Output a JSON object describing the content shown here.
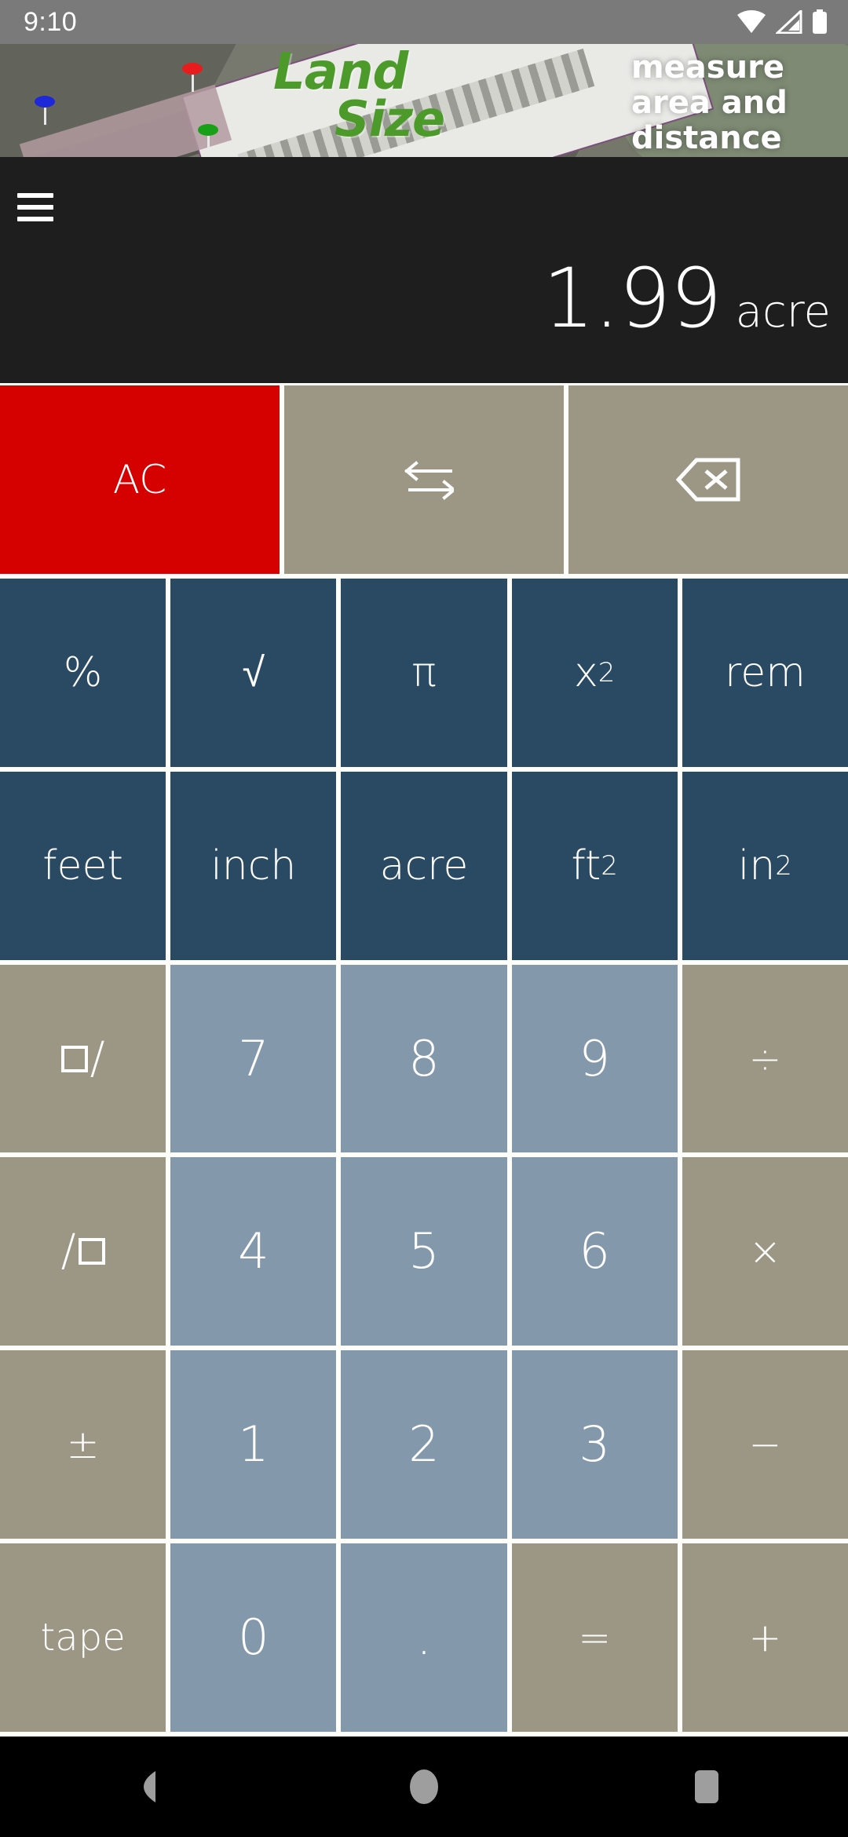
{
  "status_bar": {
    "time": "9:10",
    "icons": [
      "wifi-icon",
      "cell-signal-icon",
      "battery-icon"
    ]
  },
  "ad_banner": {
    "logo_line1": "Land",
    "logo_line2": "Size",
    "tagline_line1": "measure",
    "tagline_line2": "area and",
    "tagline_line3": "distance",
    "pins": [
      "red-map-pin",
      "blue-map-pin",
      "green-map-pin"
    ]
  },
  "display": {
    "menu_icon": "hamburger-menu-icon",
    "value": "1.99",
    "unit": "acre"
  },
  "keypad": {
    "row_top": [
      {
        "name": "all-clear-button",
        "label": "AC",
        "style": "ac"
      },
      {
        "name": "swap-units-button",
        "label": "⇆",
        "style": "tan"
      },
      {
        "name": "backspace-button",
        "label": "⌫",
        "style": "tan"
      }
    ],
    "row_functions": [
      {
        "name": "percent-button",
        "label": "%",
        "style": "blue"
      },
      {
        "name": "square-root-button",
        "label": "√",
        "style": "blue"
      },
      {
        "name": "pi-button",
        "label": "π",
        "style": "blue"
      },
      {
        "name": "x-squared-button",
        "label": "x²",
        "style": "blue"
      },
      {
        "name": "remainder-button",
        "label": "rem",
        "style": "blue"
      }
    ],
    "row_units": [
      {
        "name": "unit-feet-button",
        "label": "feet",
        "style": "blue"
      },
      {
        "name": "unit-inch-button",
        "label": "inch",
        "style": "blue"
      },
      {
        "name": "unit-acre-button",
        "label": "acre",
        "style": "blue"
      },
      {
        "name": "unit-square-feet-button",
        "label": "ft²",
        "style": "blue"
      },
      {
        "name": "unit-square-inch-button",
        "label": "in²",
        "style": "blue"
      }
    ],
    "row_7": [
      {
        "name": "fraction-numerator-button",
        "label": "□/",
        "style": "tan"
      },
      {
        "name": "digit-7-button",
        "label": "7",
        "style": "digit"
      },
      {
        "name": "digit-8-button",
        "label": "8",
        "style": "digit"
      },
      {
        "name": "digit-9-button",
        "label": "9",
        "style": "digit"
      },
      {
        "name": "divide-button",
        "label": "÷",
        "style": "tan"
      }
    ],
    "row_4": [
      {
        "name": "fraction-denominator-button",
        "label": "/□",
        "style": "tan"
      },
      {
        "name": "digit-4-button",
        "label": "4",
        "style": "digit"
      },
      {
        "name": "digit-5-button",
        "label": "5",
        "style": "digit"
      },
      {
        "name": "digit-6-button",
        "label": "6",
        "style": "digit"
      },
      {
        "name": "multiply-button",
        "label": "×",
        "style": "tan"
      }
    ],
    "row_1": [
      {
        "name": "plus-minus-button",
        "label": "±",
        "style": "tan"
      },
      {
        "name": "digit-1-button",
        "label": "1",
        "style": "digit"
      },
      {
        "name": "digit-2-button",
        "label": "2",
        "style": "digit"
      },
      {
        "name": "digit-3-button",
        "label": "3",
        "style": "digit"
      },
      {
        "name": "minus-button",
        "label": "−",
        "style": "tan"
      }
    ],
    "row_0": [
      {
        "name": "tape-button",
        "label": "tape",
        "style": "tan"
      },
      {
        "name": "digit-0-button",
        "label": "0",
        "style": "digit"
      },
      {
        "name": "decimal-point-button",
        "label": ".",
        "style": "digit"
      },
      {
        "name": "equals-button",
        "label": "=",
        "style": "tan"
      },
      {
        "name": "plus-button",
        "label": "+",
        "style": "tan"
      }
    ]
  },
  "nav_bar": {
    "back": "back-triangle-icon",
    "home": "home-circle-icon",
    "recents": "recents-square-icon"
  },
  "colors": {
    "accent_red": "#d50000",
    "function_blue": "#2a4a64",
    "digit_blue": "#8498ac",
    "operator_tan": "#9c9685",
    "display_bg": "#1e1e1e",
    "status_bg": "#7a7a7a",
    "logo_green": "#4c9b2a"
  }
}
